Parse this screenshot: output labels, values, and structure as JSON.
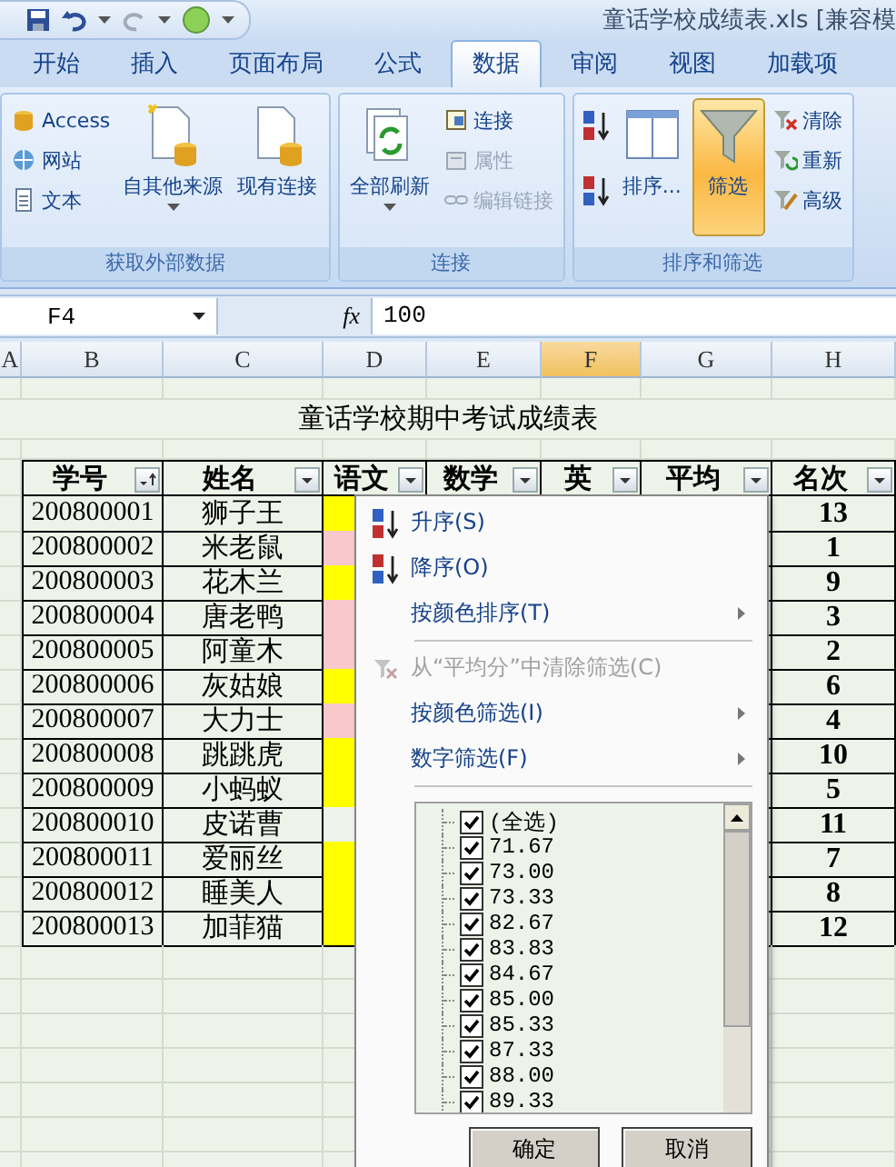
{
  "window": {
    "title": "童话学校成绩表.xls  [兼容模"
  },
  "ribbon_tabs": [
    {
      "label": "开始",
      "selected": false
    },
    {
      "label": "插入",
      "selected": false
    },
    {
      "label": "页面布局",
      "selected": false
    },
    {
      "label": "公式",
      "selected": false
    },
    {
      "label": "数据",
      "selected": true
    },
    {
      "label": "审阅",
      "selected": false
    },
    {
      "label": "视图",
      "selected": false
    },
    {
      "label": "加载项",
      "selected": false
    }
  ],
  "ribbon_groups": [
    {
      "title": "获取外部数据",
      "columns": [
        {
          "kind": "small",
          "items": [
            {
              "label": "Access",
              "disabled": false
            },
            {
              "label": "网站",
              "disabled": false
            },
            {
              "label": "文本",
              "disabled": false
            }
          ]
        },
        {
          "kind": "large",
          "label": "自其他来源",
          "dropdown": true,
          "selected": false
        },
        {
          "kind": "large",
          "label": "现有连接",
          "dropdown": false,
          "selected": false
        }
      ]
    },
    {
      "title": "连接",
      "columns": [
        {
          "kind": "large",
          "label": "全部刷新",
          "dropdown": true,
          "selected": false
        },
        {
          "kind": "small",
          "items": [
            {
              "label": "连接",
              "disabled": false
            },
            {
              "label": "属性",
              "disabled": true
            },
            {
              "label": "编辑链接",
              "disabled": true
            }
          ]
        }
      ]
    },
    {
      "title": "排序和筛选",
      "columns": [
        {
          "kind": "sort_buttons"
        },
        {
          "kind": "large",
          "label": "排序...",
          "dropdown": false,
          "selected": false
        },
        {
          "kind": "large",
          "label": "筛选",
          "dropdown": false,
          "selected": true
        },
        {
          "kind": "small",
          "items": [
            {
              "label": "清除",
              "disabled": false
            },
            {
              "label": "重新",
              "disabled": false
            },
            {
              "label": "高级",
              "disabled": false
            }
          ]
        }
      ]
    }
  ],
  "formula_bar": {
    "name_box": "F4",
    "fx_label": "fx",
    "value": "100"
  },
  "column_letters": [
    {
      "label": "A",
      "selected": false
    },
    {
      "label": "B",
      "selected": false
    },
    {
      "label": "C",
      "selected": false
    },
    {
      "label": "D",
      "selected": false
    },
    {
      "label": "E",
      "selected": false
    },
    {
      "label": "F",
      "selected": true
    },
    {
      "label": "G",
      "selected": false
    },
    {
      "label": "H",
      "selected": false
    }
  ],
  "sheet_title": "童话学校期中考试成绩表",
  "table_headers": [
    {
      "label": "学号",
      "sorted": true
    },
    {
      "label": "姓名",
      "sorted": false
    },
    {
      "label": "语文",
      "sorted": false
    },
    {
      "label": "数学",
      "sorted": false
    },
    {
      "label": "英",
      "sorted": false
    },
    {
      "label": "平均",
      "sorted": false
    },
    {
      "label": "名次",
      "sorted": false
    }
  ],
  "rows": [
    {
      "id": "200800001",
      "name": "狮子王",
      "color": "#ffff00",
      "rank": "13"
    },
    {
      "id": "200800002",
      "name": "米老鼠",
      "color": "#f8c8cc",
      "rank": "1"
    },
    {
      "id": "200800003",
      "name": "花木兰",
      "color": "#ffff00",
      "rank": "9"
    },
    {
      "id": "200800004",
      "name": "唐老鸭",
      "color": "#f8c8cc",
      "rank": "3"
    },
    {
      "id": "200800005",
      "name": "阿童木",
      "color": "#f8c8cc",
      "rank": "2"
    },
    {
      "id": "200800006",
      "name": "灰姑娘",
      "color": "#ffff00",
      "rank": "6"
    },
    {
      "id": "200800007",
      "name": "大力士",
      "color": "#f8c8cc",
      "rank": "4"
    },
    {
      "id": "200800008",
      "name": "跳跳虎",
      "color": "#ffff00",
      "rank": "10"
    },
    {
      "id": "200800009",
      "name": "小蚂蚁",
      "color": "#ffff00",
      "rank": "5"
    },
    {
      "id": "200800010",
      "name": "皮诺曹",
      "color": "#eef3ea",
      "rank": "11"
    },
    {
      "id": "200800011",
      "name": "爱丽丝",
      "color": "#ffff00",
      "rank": "7"
    },
    {
      "id": "200800012",
      "name": "睡美人",
      "color": "#ffff00",
      "rank": "8"
    },
    {
      "id": "200800013",
      "name": "加菲猫",
      "color": "#ffff00",
      "rank": "12"
    }
  ],
  "filter_menu": {
    "items": [
      {
        "kind": "sort_asc",
        "label": "升序(S)",
        "disabled": false,
        "submenu": false
      },
      {
        "kind": "sort_desc",
        "label": "降序(O)",
        "disabled": false,
        "submenu": false
      },
      {
        "kind": "item",
        "label": "按颜色排序(T)",
        "disabled": false,
        "submenu": true
      },
      {
        "kind": "separator"
      },
      {
        "kind": "clear",
        "label": "从“平均分”中清除筛选(C)",
        "disabled": true,
        "submenu": false
      },
      {
        "kind": "item",
        "label": "按颜色筛选(I)",
        "disabled": false,
        "submenu": true
      },
      {
        "kind": "item",
        "label": "数字筛选(F)",
        "disabled": false,
        "submenu": true
      }
    ],
    "values": [
      {
        "label": "(全选)",
        "checked": true
      },
      {
        "label": "71.67",
        "checked": true
      },
      {
        "label": "73.00",
        "checked": true
      },
      {
        "label": "73.33",
        "checked": true
      },
      {
        "label": "82.67",
        "checked": true
      },
      {
        "label": "83.83",
        "checked": true
      },
      {
        "label": "84.67",
        "checked": true
      },
      {
        "label": "85.00",
        "checked": true
      },
      {
        "label": "85.33",
        "checked": true
      },
      {
        "label": "87.33",
        "checked": true
      },
      {
        "label": "88.00",
        "checked": true
      },
      {
        "label": "89.33",
        "checked": true
      }
    ],
    "buttons": [
      "确定",
      "取消"
    ]
  }
}
